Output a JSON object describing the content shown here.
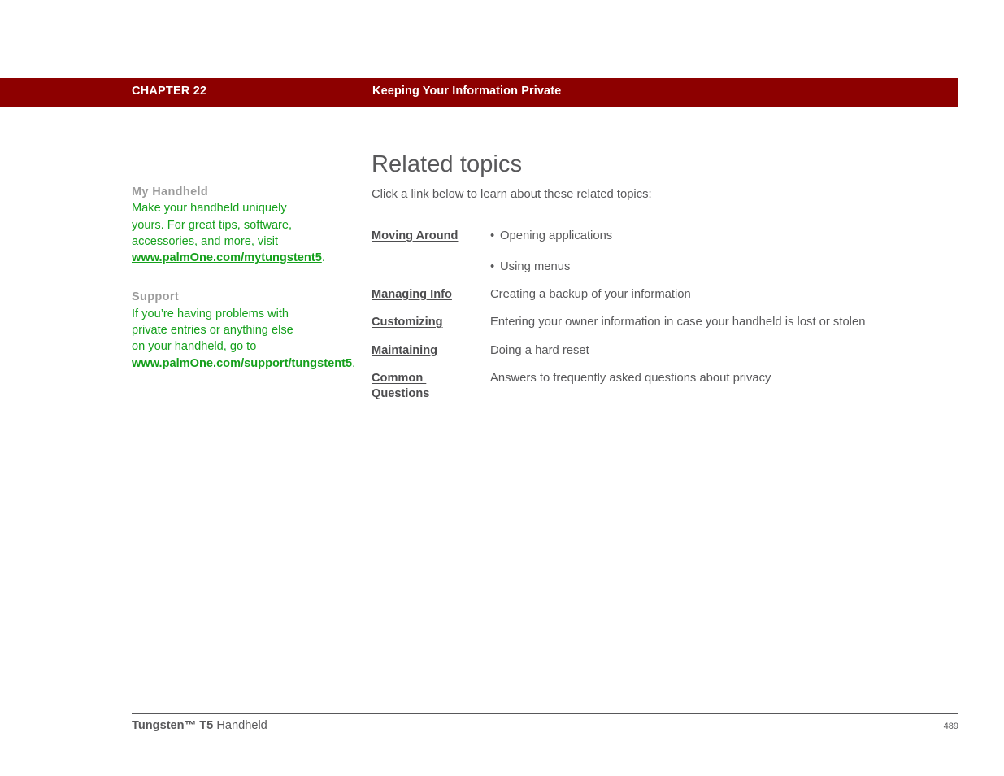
{
  "header": {
    "chapter": "CHAPTER 22",
    "title": "Keeping Your Information Private",
    "bar_color": "#8d0000",
    "text_color": "#ffffff"
  },
  "sidebar": {
    "accent_color": "#15a01c",
    "heading_color": "#9b9b9b",
    "blocks": [
      {
        "heading": "My Handheld",
        "body_before": "Make your handheld uniquely yours. For great tips, software, accessories, and more, visit ",
        "link": "www.palmOne.com/mytungstent5",
        "body_after": "."
      },
      {
        "heading": "Support",
        "body_before": "If you’re having problems with private entries or anything else on your handheld, go to ",
        "link": "www.palmOne.com/support/tungstent5",
        "body_after": "."
      }
    ]
  },
  "main": {
    "title": "Related topics",
    "intro": "Click a link below to learn about these related topics:",
    "text_color": "#58585a"
  },
  "topics": [
    {
      "link": "Moving Around",
      "bullets": [
        "Opening applications",
        "Using menus"
      ],
      "bullet_glyph": "•"
    },
    {
      "link": "Managing Info",
      "description": "Creating a backup of your information"
    },
    {
      "link": "Customizing",
      "description": "Entering your owner information in case your handheld is lost or stolen"
    },
    {
      "link": "Maintaining",
      "description": "Doing a hard reset"
    },
    {
      "link": "Common \nQuestions",
      "description": "Answers to frequently asked questions about privacy"
    }
  ],
  "footer": {
    "brand": "Tungsten™ T5",
    "product": " Handheld",
    "page_number": "489"
  }
}
